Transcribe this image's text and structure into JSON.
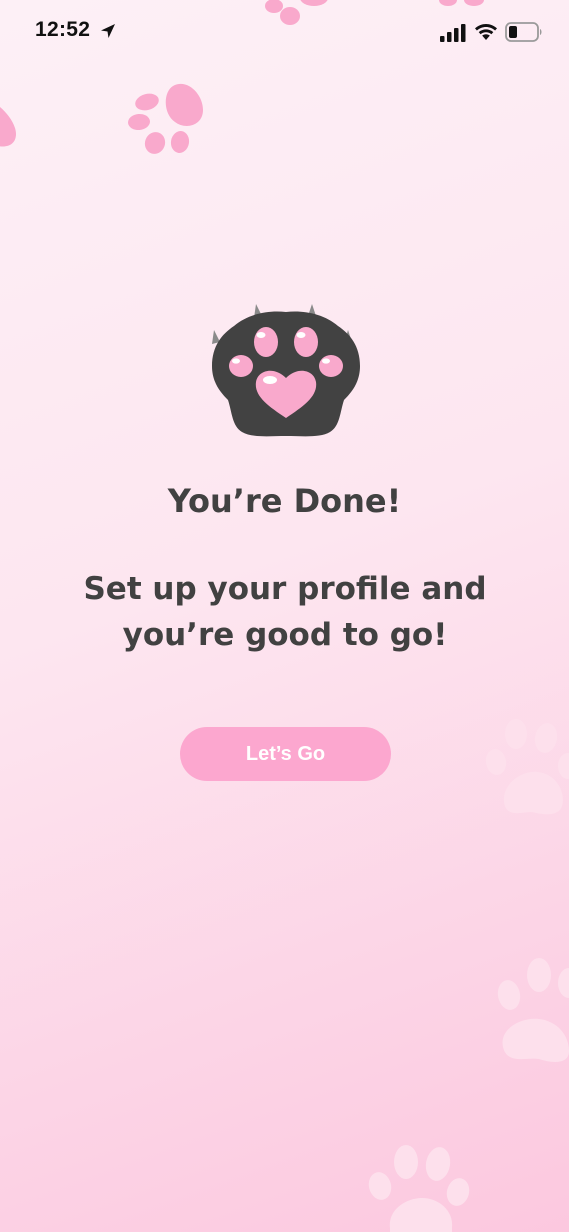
{
  "status_bar": {
    "time": "12:52",
    "icons": [
      "location-arrow-icon",
      "signal-bars-icon",
      "wifi-icon",
      "battery-icon"
    ]
  },
  "content": {
    "title": "You’re Done!",
    "subtitle_line1": "Set up your profile and",
    "subtitle_line2": "you’re good to go!",
    "hero_icon": "cat-paw-heart-icon",
    "button_label": "Let’s Go"
  },
  "background": {
    "decoration_icon": "paw-print-icon"
  },
  "colors": {
    "background_top": "#fdf0f6",
    "background_bottom": "#fcc8df",
    "text": "#414141",
    "button": "#fca7cf",
    "button_text": "#ffffff",
    "paw_dark": "#424242",
    "paw_pink": "#f9a9cc",
    "decor_pink": "#f9a9cc",
    "decor_light": "#fde0ec"
  }
}
